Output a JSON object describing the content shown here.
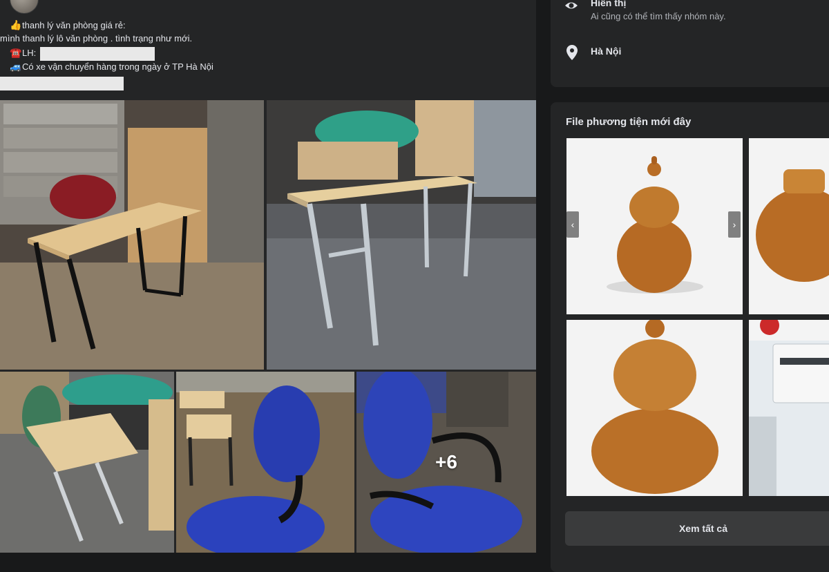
{
  "post": {
    "lines": [
      {
        "emoji": "👍",
        "text": "thanh lý văn phòng giá rẻ:"
      },
      {
        "emoji": "",
        "text": "mình thanh lý lô văn phòng . tình trạng như mới."
      },
      {
        "emoji": "☎️",
        "text": "LH:"
      },
      {
        "emoji": "🚙",
        "text": "Có xe vận chuyển hàng trong ngày ở TP Hà Nội"
      }
    ],
    "more_photos": "+6"
  },
  "about": {
    "visibility_title": "Hiển thị",
    "visibility_desc": "Ai cũng có thể tìm thấy nhóm này.",
    "location": "Hà Nội"
  },
  "media": {
    "title": "File phương tiện mới đây",
    "see_all": "Xem tất cả"
  }
}
